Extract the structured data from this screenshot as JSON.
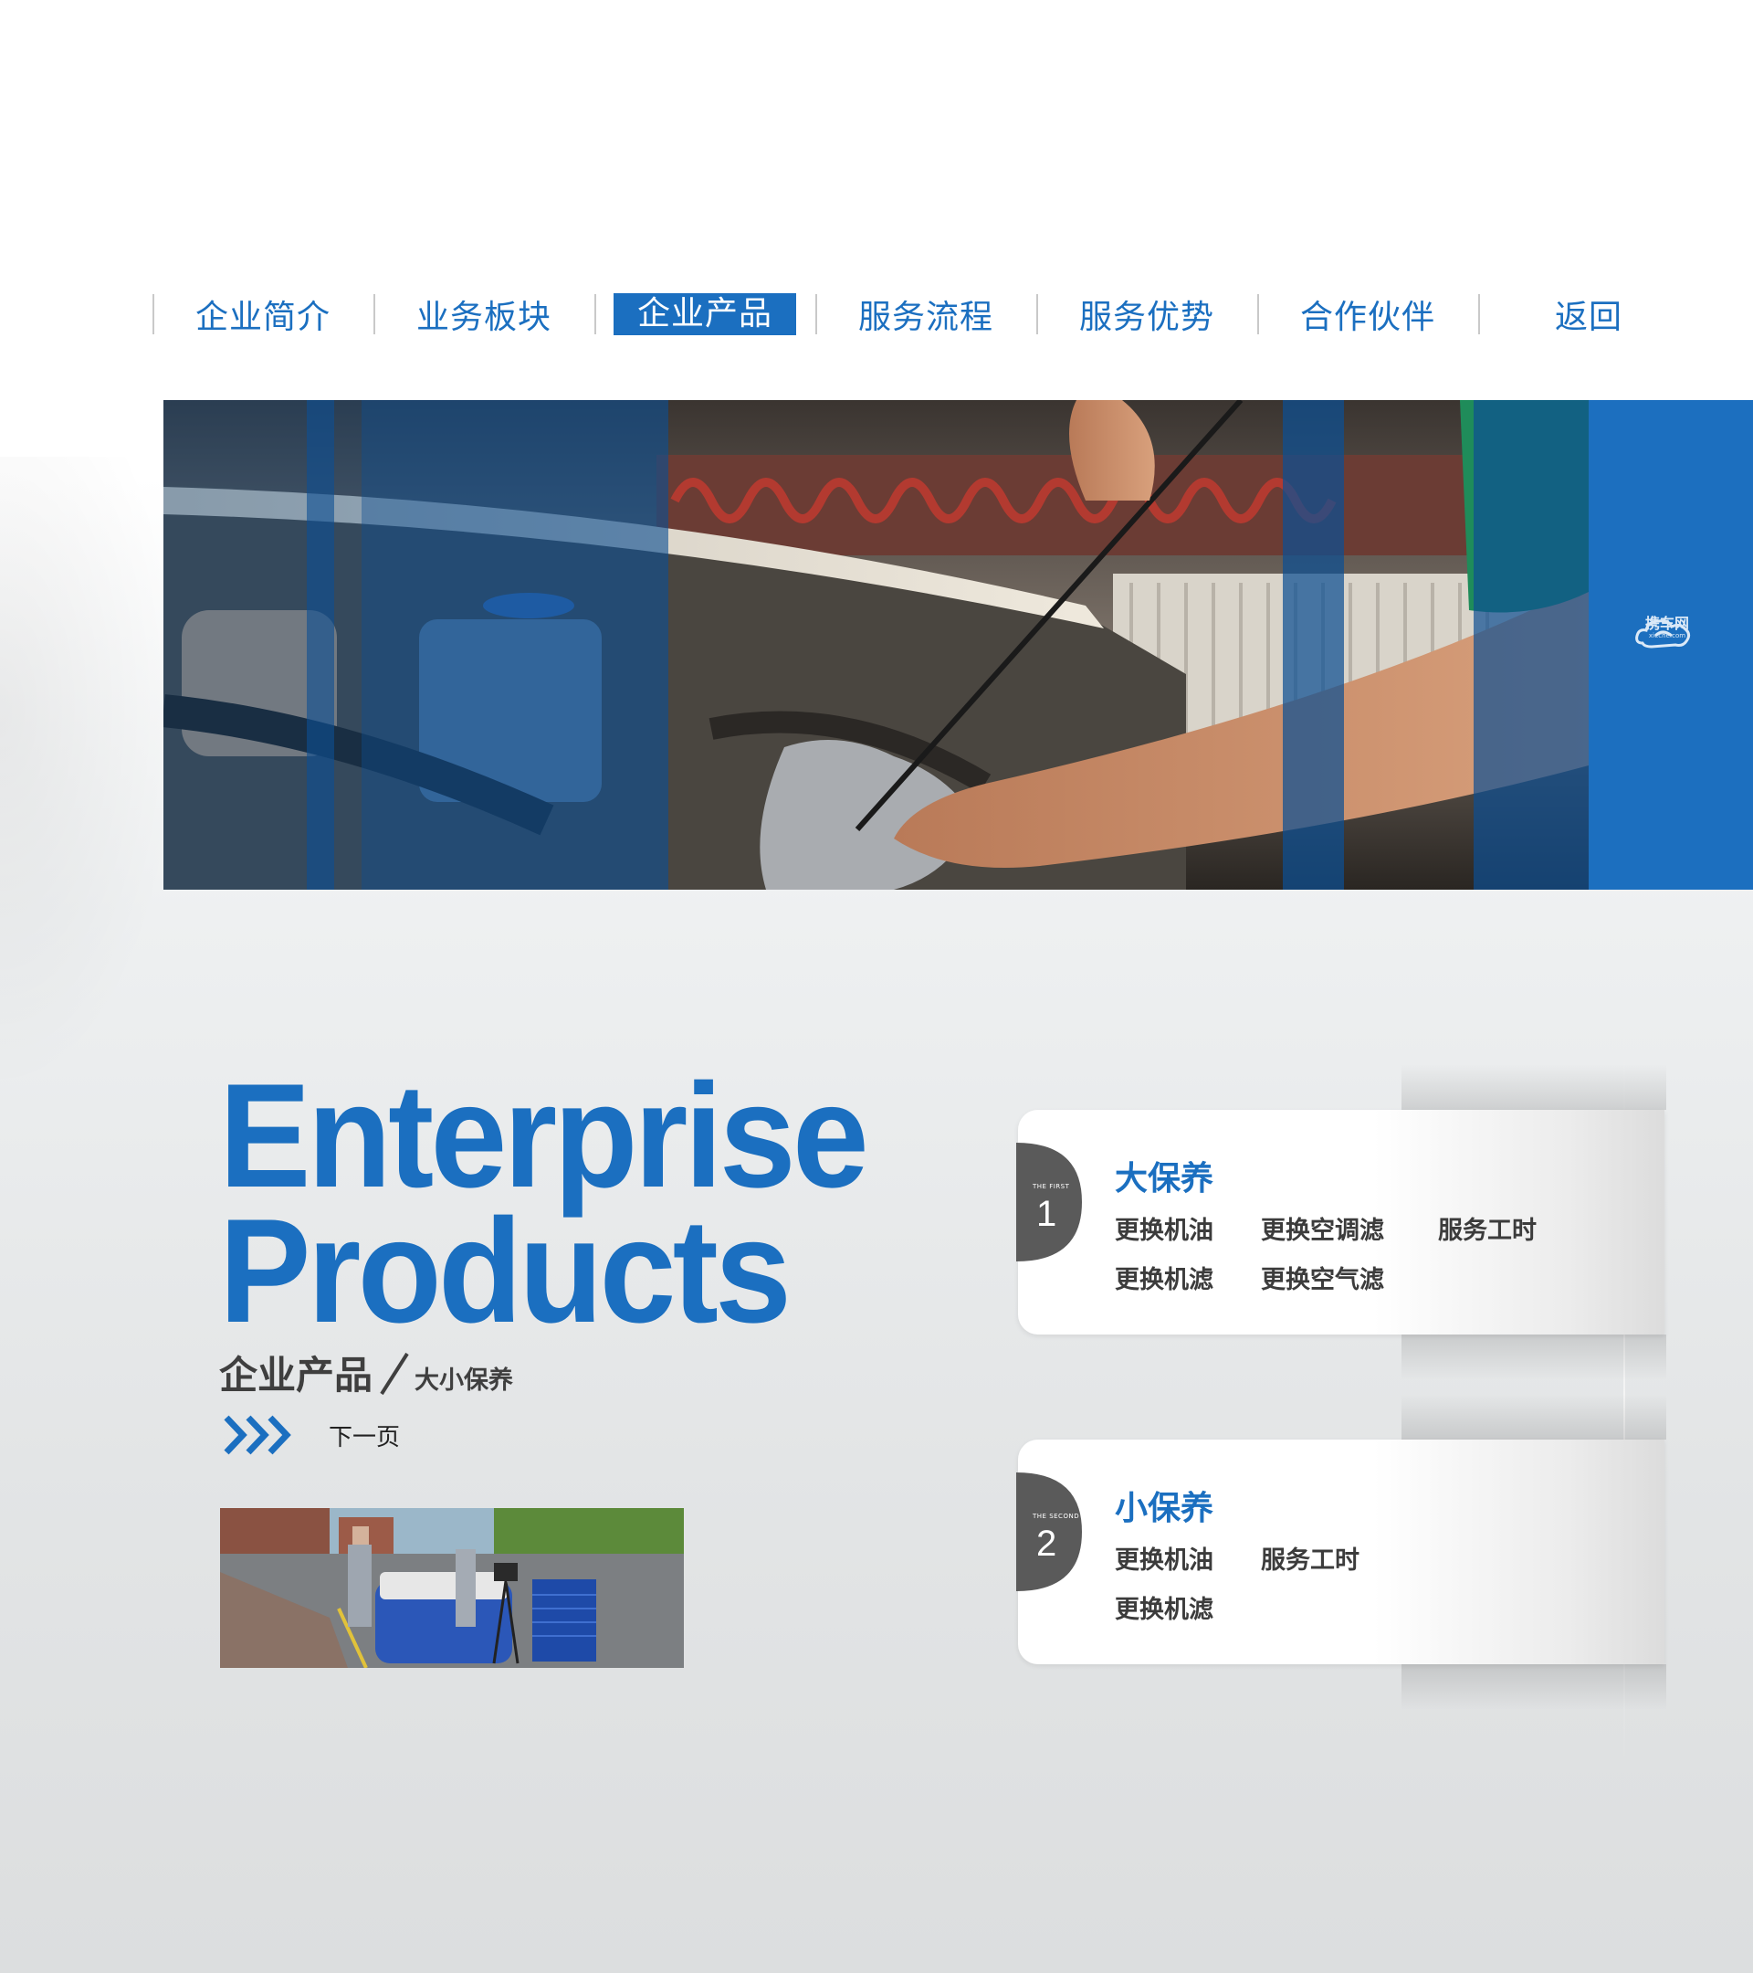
{
  "nav": {
    "items": [
      {
        "label": "企业简介",
        "active": false
      },
      {
        "label": "业务板块",
        "active": false
      },
      {
        "label": "企业产品",
        "active": true
      },
      {
        "label": "服务流程",
        "active": false
      },
      {
        "label": "服务优势",
        "active": false
      },
      {
        "label": "合作伙伴",
        "active": false
      },
      {
        "label": "返回",
        "active": false
      }
    ]
  },
  "hero": {
    "logo_text": "携车网",
    "logo_sub": "xieche.com"
  },
  "headline": {
    "line1": "Enterprise",
    "line2": "Products",
    "subtitle_main": "企业产品",
    "subtitle_sub": "大小保养",
    "next_label": "下一页"
  },
  "cards": [
    {
      "badge_caption": "THE FIRST",
      "badge_number": "1",
      "title": "大保养",
      "services": [
        "更换机油",
        "更换空调滤",
        "服务工时",
        "更换机滤",
        "更换空气滤"
      ]
    },
    {
      "badge_caption": "THE SECOND",
      "badge_number": "2",
      "title": "小保养",
      "services": [
        "更换机油",
        "服务工时",
        "更换机滤"
      ]
    }
  ],
  "colors": {
    "brand_blue": "#1b6fc0",
    "text_dark": "#3c3c3c",
    "badge_gray": "#5a5a5a"
  }
}
